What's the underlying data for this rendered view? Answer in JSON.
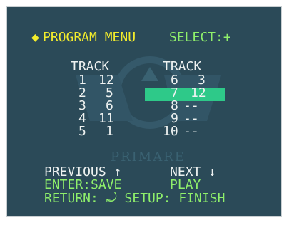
{
  "header": {
    "marker": "◆",
    "title": "PROGRAM MENU",
    "select_label": "SELECT:+"
  },
  "columns": {
    "left_header": "TRACK",
    "right_header": "TRACK"
  },
  "left_rows": [
    {
      "slot": "1",
      "track": "12"
    },
    {
      "slot": "2",
      "track": "5"
    },
    {
      "slot": "3",
      "track": "6"
    },
    {
      "slot": "4",
      "track": "11"
    },
    {
      "slot": "5",
      "track": "1"
    }
  ],
  "right_rows": [
    {
      "slot": "6",
      "track": "3"
    },
    {
      "slot": "7",
      "track": "12"
    },
    {
      "slot": "8",
      "track": "--"
    },
    {
      "slot": "9",
      "track": "--"
    },
    {
      "slot": "10",
      "track": "--"
    }
  ],
  "selected_right_row_index": 1,
  "footer": {
    "previous": "PREVIOUS ↑",
    "next": "NEXT ↓",
    "enter_save": "ENTER:SAVE",
    "play": "PLAY",
    "return_setup": "RETURN: ⤾ SETUP: FINISH"
  },
  "watermark": {
    "brand": "PRIMARE"
  },
  "colors": {
    "screen_bg": "#2b4a58",
    "title_yellow": "#f3ec2c",
    "hint_green": "#8ff06b",
    "text_white": "#eef2f1",
    "highlight": "#2ec989"
  }
}
